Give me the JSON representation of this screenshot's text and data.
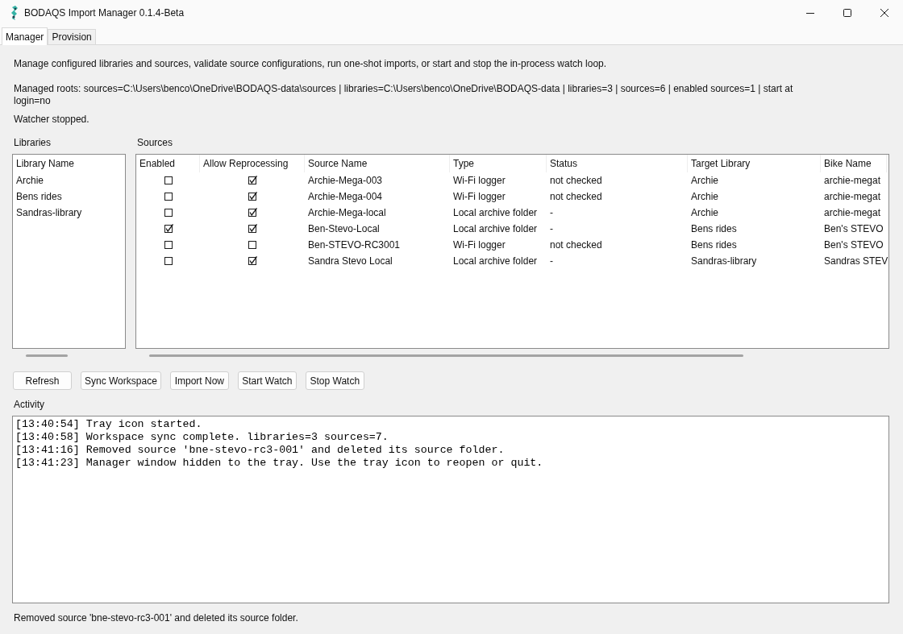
{
  "window": {
    "title": "BODAQS Import Manager 0.1.4-Beta"
  },
  "tabs": [
    {
      "label": "Manager",
      "selected": true
    },
    {
      "label": "Provision",
      "selected": false
    }
  ],
  "manager": {
    "description": "Manage configured libraries and sources, validate source configurations, run one-shot imports, or start and stop the in-process watch loop.",
    "managed_roots": "Managed roots: sources=C:\\Users\\benco\\OneDrive\\BODAQS-data\\sources | libraries=C:\\Users\\benco\\OneDrive\\BODAQS-data | libraries=3 | sources=6 | enabled sources=1 | start at login=no",
    "watcher_status": "Watcher stopped.",
    "libraries": {
      "label": "Libraries",
      "columns": [
        "Library Name"
      ],
      "rows": [
        "Archie",
        "Bens rides",
        "Sandras-library"
      ]
    },
    "sources": {
      "label": "Sources",
      "columns": [
        "Enabled",
        "Allow Reprocessing",
        "Source Name",
        "Type",
        "Status",
        "Target Library",
        "Bike Name"
      ],
      "rows": [
        {
          "enabled": false,
          "allow_reprocessing": true,
          "source_name": "Archie-Mega-003",
          "type": "Wi-Fi logger",
          "status": "not checked",
          "target_library": "Archie",
          "bike_name": "archie-megat"
        },
        {
          "enabled": false,
          "allow_reprocessing": true,
          "source_name": "Archie-Mega-004",
          "type": "Wi-Fi logger",
          "status": "not checked",
          "target_library": "Archie",
          "bike_name": "archie-megat"
        },
        {
          "enabled": false,
          "allow_reprocessing": true,
          "source_name": "Archie-Mega-local",
          "type": "Local archive folder",
          "status": "-",
          "target_library": "Archie",
          "bike_name": "archie-megat"
        },
        {
          "enabled": true,
          "allow_reprocessing": true,
          "source_name": "Ben-Stevo-Local",
          "type": "Local archive folder",
          "status": "-",
          "target_library": "Bens rides",
          "bike_name": "Ben's STEVO"
        },
        {
          "enabled": false,
          "allow_reprocessing": false,
          "source_name": "Ben-STEVO-RC3001",
          "type": "Wi-Fi logger",
          "status": "not checked",
          "target_library": "Bens rides",
          "bike_name": "Ben's STEVO"
        },
        {
          "enabled": false,
          "allow_reprocessing": true,
          "source_name": "Sandra Stevo Local",
          "type": "Local archive folder",
          "status": "-",
          "target_library": "Sandras-library",
          "bike_name": "Sandras STEV"
        }
      ]
    },
    "buttons": [
      "Refresh",
      "Sync Workspace",
      "Import Now",
      "Start Watch",
      "Stop Watch"
    ],
    "activity": {
      "label": "Activity",
      "lines": [
        "[13:40:54] Tray icon started.",
        "[13:40:58] Workspace sync complete. libraries=3 sources=7.",
        "[13:41:16] Removed source 'bne-stevo-rc3-001' and deleted its source folder.",
        "[13:41:23] Manager window hidden to the tray. Use the tray icon to reopen or quit."
      ]
    }
  },
  "status_bar": "Removed source 'bne-stevo-rc3-001' and deleted its source folder."
}
